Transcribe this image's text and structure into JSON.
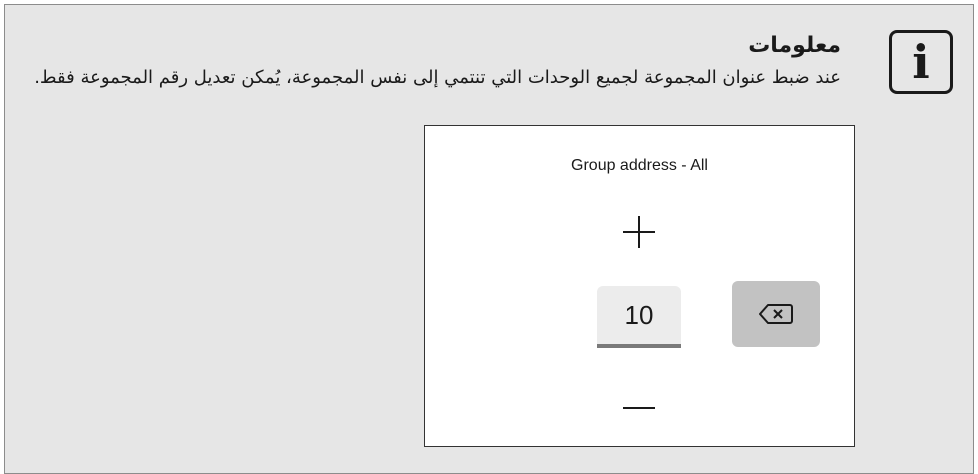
{
  "note": {
    "icon": "info-icon",
    "icon_glyph": "i",
    "title": "معلومات",
    "body": "عند ضبط عنوان المجموعة لجميع الوحدات التي تنتمي إلى نفس المجموعة، يُمكن تعديل رقم المجموعة فقط."
  },
  "screen": {
    "title": "Group address - All",
    "value": "10",
    "controls": {
      "increment_icon": "plus-icon",
      "decrement_icon": "minus-icon",
      "backspace_icon": "backspace-icon"
    }
  },
  "colors": {
    "note_background": "#e6e6e6",
    "backspace_button": "#c2c2c2",
    "value_underline": "#7a7a7a"
  }
}
